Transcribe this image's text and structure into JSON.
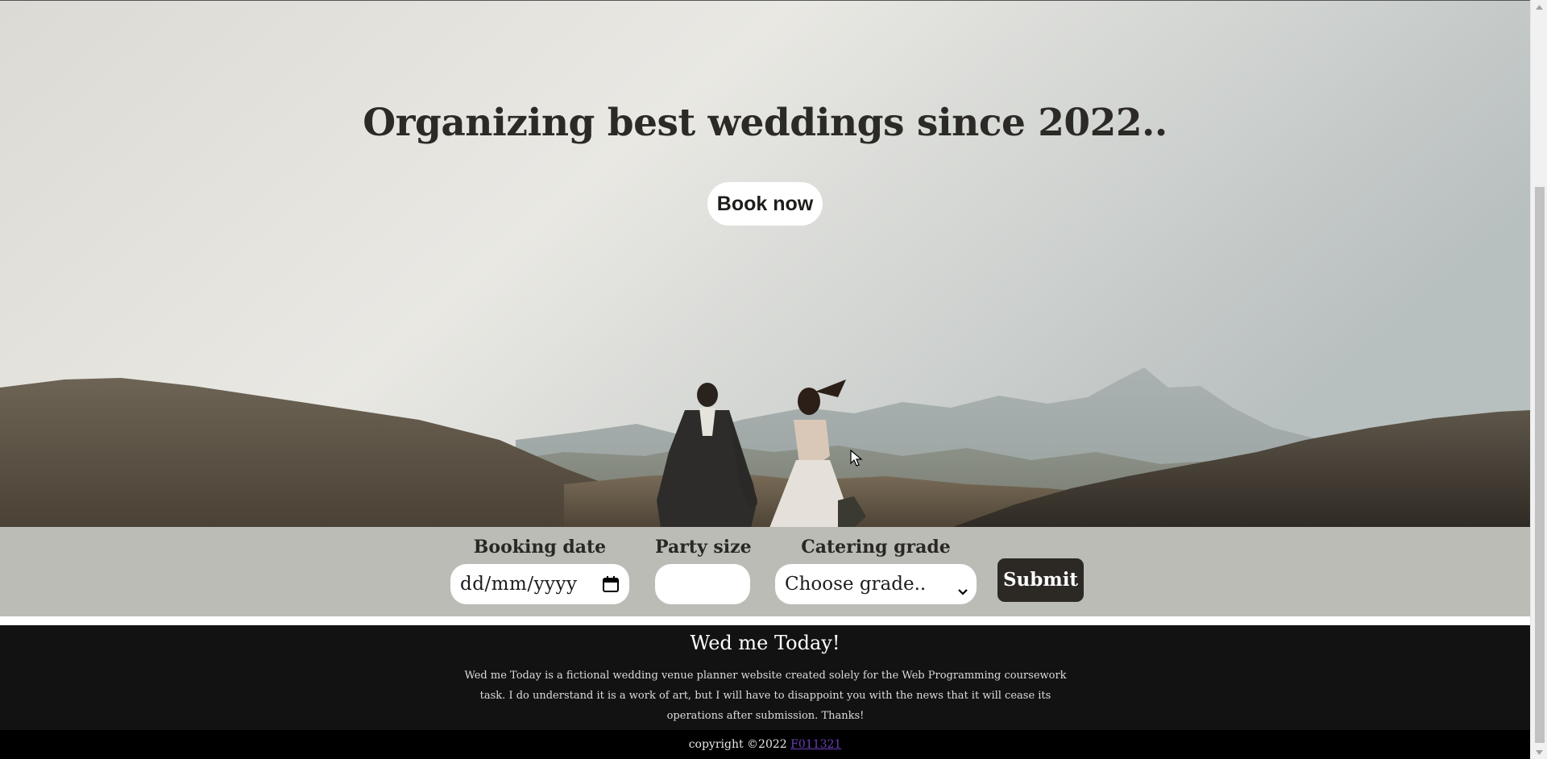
{
  "hero": {
    "title": "Organizing best weddings since 2022..",
    "book_button_label": "Book now"
  },
  "booking_form": {
    "date": {
      "label": "Booking date",
      "placeholder": "dd/mm/yyyy"
    },
    "party_size": {
      "label": "Party size",
      "value": ""
    },
    "catering": {
      "label": "Catering grade",
      "selected": "Choose grade.."
    },
    "submit_label": "Submit"
  },
  "footer": {
    "title": "Wed me Today!",
    "description": "Wed me Today is a fictional wedding venue planner website created solely for the Web Programming coursework task. I do understand it is a work of art, but I will have to disappoint you with the news that it will cease its operations after submission. Thanks!",
    "copyright_prefix": "copyright ©2022 ",
    "copyright_link": "F011321"
  },
  "icons": {
    "calendar": "calendar-icon",
    "dropdown": "chevron-down-icon",
    "cursor": "mouse-pointer-icon"
  },
  "colors": {
    "form_bar": "#babcb5",
    "footer_bg": "#121212",
    "copyright_bg": "#000000",
    "submit_bg": "#2c2925",
    "link": "#6b3fb8"
  }
}
